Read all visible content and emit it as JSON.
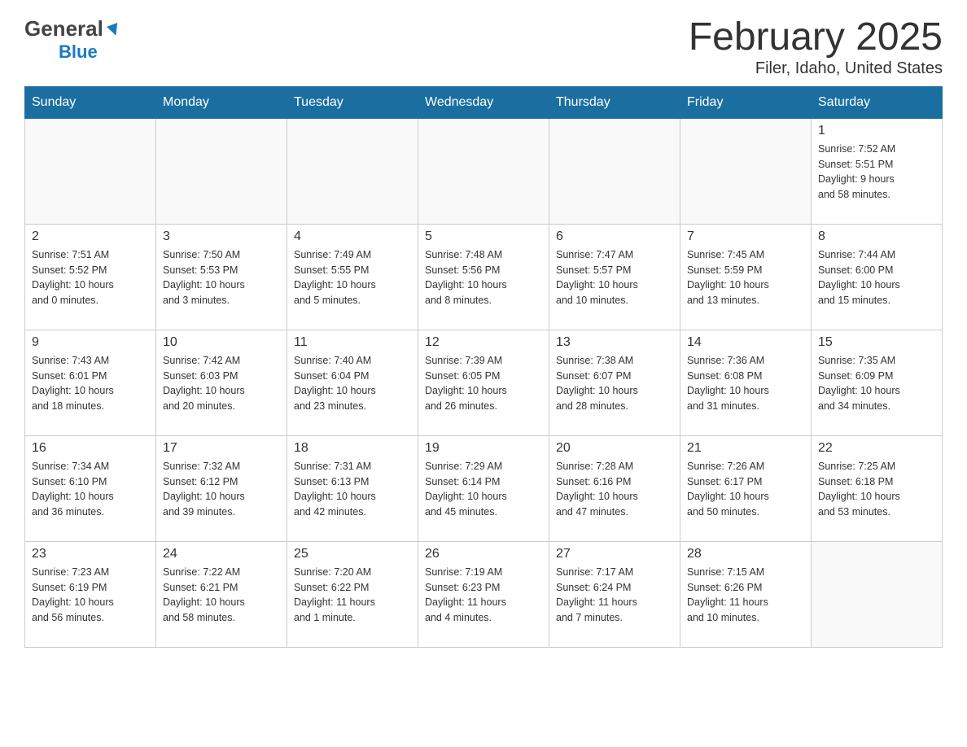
{
  "logo": {
    "general": "General",
    "blue": "Blue"
  },
  "title": "February 2025",
  "subtitle": "Filer, Idaho, United States",
  "weekdays": [
    "Sunday",
    "Monday",
    "Tuesday",
    "Wednesday",
    "Thursday",
    "Friday",
    "Saturday"
  ],
  "weeks": [
    [
      {
        "day": "",
        "info": ""
      },
      {
        "day": "",
        "info": ""
      },
      {
        "day": "",
        "info": ""
      },
      {
        "day": "",
        "info": ""
      },
      {
        "day": "",
        "info": ""
      },
      {
        "day": "",
        "info": ""
      },
      {
        "day": "1",
        "info": "Sunrise: 7:52 AM\nSunset: 5:51 PM\nDaylight: 9 hours\nand 58 minutes."
      }
    ],
    [
      {
        "day": "2",
        "info": "Sunrise: 7:51 AM\nSunset: 5:52 PM\nDaylight: 10 hours\nand 0 minutes."
      },
      {
        "day": "3",
        "info": "Sunrise: 7:50 AM\nSunset: 5:53 PM\nDaylight: 10 hours\nand 3 minutes."
      },
      {
        "day": "4",
        "info": "Sunrise: 7:49 AM\nSunset: 5:55 PM\nDaylight: 10 hours\nand 5 minutes."
      },
      {
        "day": "5",
        "info": "Sunrise: 7:48 AM\nSunset: 5:56 PM\nDaylight: 10 hours\nand 8 minutes."
      },
      {
        "day": "6",
        "info": "Sunrise: 7:47 AM\nSunset: 5:57 PM\nDaylight: 10 hours\nand 10 minutes."
      },
      {
        "day": "7",
        "info": "Sunrise: 7:45 AM\nSunset: 5:59 PM\nDaylight: 10 hours\nand 13 minutes."
      },
      {
        "day": "8",
        "info": "Sunrise: 7:44 AM\nSunset: 6:00 PM\nDaylight: 10 hours\nand 15 minutes."
      }
    ],
    [
      {
        "day": "9",
        "info": "Sunrise: 7:43 AM\nSunset: 6:01 PM\nDaylight: 10 hours\nand 18 minutes."
      },
      {
        "day": "10",
        "info": "Sunrise: 7:42 AM\nSunset: 6:03 PM\nDaylight: 10 hours\nand 20 minutes."
      },
      {
        "day": "11",
        "info": "Sunrise: 7:40 AM\nSunset: 6:04 PM\nDaylight: 10 hours\nand 23 minutes."
      },
      {
        "day": "12",
        "info": "Sunrise: 7:39 AM\nSunset: 6:05 PM\nDaylight: 10 hours\nand 26 minutes."
      },
      {
        "day": "13",
        "info": "Sunrise: 7:38 AM\nSunset: 6:07 PM\nDaylight: 10 hours\nand 28 minutes."
      },
      {
        "day": "14",
        "info": "Sunrise: 7:36 AM\nSunset: 6:08 PM\nDaylight: 10 hours\nand 31 minutes."
      },
      {
        "day": "15",
        "info": "Sunrise: 7:35 AM\nSunset: 6:09 PM\nDaylight: 10 hours\nand 34 minutes."
      }
    ],
    [
      {
        "day": "16",
        "info": "Sunrise: 7:34 AM\nSunset: 6:10 PM\nDaylight: 10 hours\nand 36 minutes."
      },
      {
        "day": "17",
        "info": "Sunrise: 7:32 AM\nSunset: 6:12 PM\nDaylight: 10 hours\nand 39 minutes."
      },
      {
        "day": "18",
        "info": "Sunrise: 7:31 AM\nSunset: 6:13 PM\nDaylight: 10 hours\nand 42 minutes."
      },
      {
        "day": "19",
        "info": "Sunrise: 7:29 AM\nSunset: 6:14 PM\nDaylight: 10 hours\nand 45 minutes."
      },
      {
        "day": "20",
        "info": "Sunrise: 7:28 AM\nSunset: 6:16 PM\nDaylight: 10 hours\nand 47 minutes."
      },
      {
        "day": "21",
        "info": "Sunrise: 7:26 AM\nSunset: 6:17 PM\nDaylight: 10 hours\nand 50 minutes."
      },
      {
        "day": "22",
        "info": "Sunrise: 7:25 AM\nSunset: 6:18 PM\nDaylight: 10 hours\nand 53 minutes."
      }
    ],
    [
      {
        "day": "23",
        "info": "Sunrise: 7:23 AM\nSunset: 6:19 PM\nDaylight: 10 hours\nand 56 minutes."
      },
      {
        "day": "24",
        "info": "Sunrise: 7:22 AM\nSunset: 6:21 PM\nDaylight: 10 hours\nand 58 minutes."
      },
      {
        "day": "25",
        "info": "Sunrise: 7:20 AM\nSunset: 6:22 PM\nDaylight: 11 hours\nand 1 minute."
      },
      {
        "day": "26",
        "info": "Sunrise: 7:19 AM\nSunset: 6:23 PM\nDaylight: 11 hours\nand 4 minutes."
      },
      {
        "day": "27",
        "info": "Sunrise: 7:17 AM\nSunset: 6:24 PM\nDaylight: 11 hours\nand 7 minutes."
      },
      {
        "day": "28",
        "info": "Sunrise: 7:15 AM\nSunset: 6:26 PM\nDaylight: 11 hours\nand 10 minutes."
      },
      {
        "day": "",
        "info": ""
      }
    ]
  ]
}
